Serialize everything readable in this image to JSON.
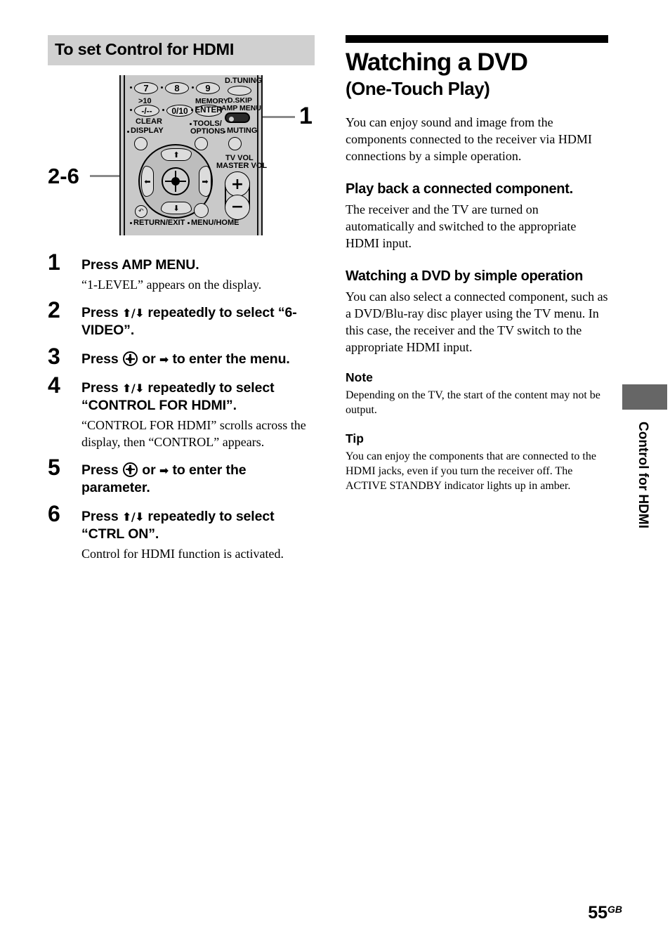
{
  "left_column": {
    "section_heading": "To set Control for HDMI",
    "remote_figure": {
      "callout_top": "1",
      "callout_left": "2-6",
      "labels": {
        "key_7": "7",
        "key_8": "8",
        "key_9": "9",
        "d_tuning": "D.TUNING",
        "gt10": ">10",
        "minus_slash": "-/--",
        "clear": "CLEAR",
        "key_0_10": "0/10",
        "memory": "MEMORY",
        "enter": "ENTER",
        "d_skip": "D.SKIP",
        "amp_menu": "AMP MENU",
        "display": "DISPLAY",
        "tools_line1": "TOOLS/",
        "tools_line2": "OPTIONS",
        "muting": "MUTING",
        "tv_vol": "TV VOL",
        "master_vol": "MASTER VOL",
        "return_exit": "RETURN/EXIT",
        "menu_home": "MENU/HOME",
        "vol_plus": "+",
        "vol_minus": "−",
        "arrow_up": "⬆",
        "arrow_down": "⬇",
        "arrow_left": "⬅",
        "arrow_right": "➡"
      }
    },
    "steps": [
      {
        "num": "1",
        "title_pre": "Press AMP MENU.",
        "body": "“1-LEVEL” appears on the display."
      },
      {
        "num": "2",
        "title_pre": "Press ",
        "title_post": " repeatedly to select “6-VIDEO”.",
        "glyph": "updown",
        "body": ""
      },
      {
        "num": "3",
        "title_pre": "Press ",
        "title_mid": " or ",
        "title_post": " to enter the menu.",
        "glyph": "enter-right",
        "body": ""
      },
      {
        "num": "4",
        "title_pre": "Press ",
        "title_post": " repeatedly to select “CONTROL FOR HDMI”.",
        "glyph": "updown",
        "body": "“CONTROL FOR HDMI” scrolls across the display, then “CONTROL” appears."
      },
      {
        "num": "5",
        "title_pre": "Press ",
        "title_mid": " or ",
        "title_post": " to enter the parameter.",
        "glyph": "enter-right",
        "body": ""
      },
      {
        "num": "6",
        "title_pre": "Press ",
        "title_post": " repeatedly to select “CTRL ON”.",
        "glyph": "updown",
        "body": "Control for HDMI function is activated."
      }
    ],
    "arrow_updown": "⬆/⬇",
    "arrow_right": "➡"
  },
  "right_column": {
    "chapter_title": "Watching a DVD",
    "chapter_subtitle": "(One-Touch Play)",
    "intro": "You can enjoy sound and image from the components connected to the receiver via HDMI connections by a simple operation.",
    "heading_playback": "Play back a connected component.",
    "playback_body": "The receiver and the TV are turned on automatically and switched to the appropriate HDMI input.",
    "heading_simple": "Watching a DVD by simple operation",
    "simple_body": "You can also select a connected component, such as a DVD/Blu-ray disc player using the TV menu. In this case, the receiver and the TV switch to the appropriate HDMI input.",
    "note_label": "Note",
    "note_body": "Depending on the TV, the start of the content may not be output.",
    "tip_label": "Tip",
    "tip_body": "You can enjoy the components that are connected to the HDMI jacks, even if you turn the receiver off. The ACTIVE STANDBY indicator lights up in amber."
  },
  "side_tab": {
    "label": "Control for HDMI"
  },
  "footer": {
    "page_number": "55",
    "page_region": "GB"
  },
  "colors": {
    "section_bar_bg": "#d0d0d0",
    "chapter_rule": "#000000",
    "side_tab_block": "#666666",
    "remote_body": "#c9c9c9",
    "callout_line": "#8a8a8a"
  }
}
